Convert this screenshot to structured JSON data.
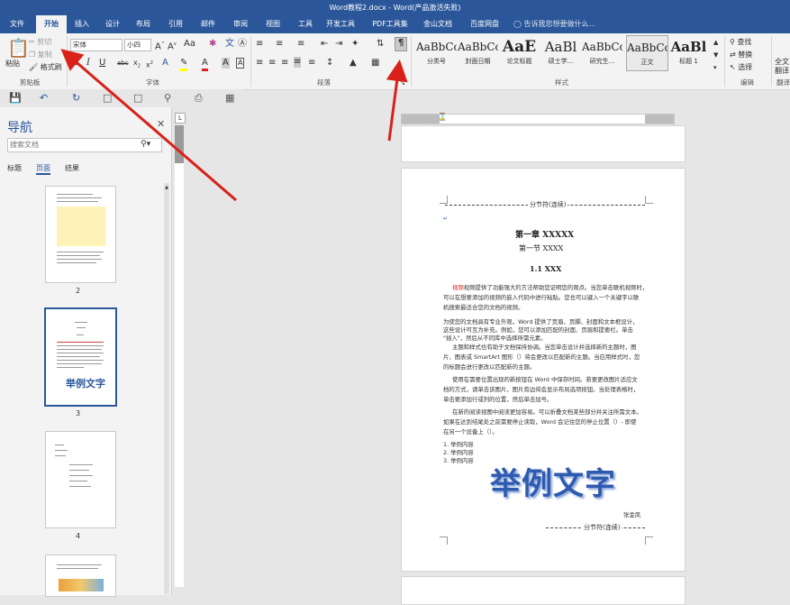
{
  "window": {
    "title": "Word教程2.docx - Word(产品激活失败)"
  },
  "tabs": [
    {
      "label": "文件"
    },
    {
      "label": "开始"
    },
    {
      "label": "插入"
    },
    {
      "label": "设计"
    },
    {
      "label": "布局"
    },
    {
      "label": "引用"
    },
    {
      "label": "邮件"
    },
    {
      "label": "审阅"
    },
    {
      "label": "视图"
    },
    {
      "label": "工具"
    },
    {
      "label": "开发工具"
    },
    {
      "label": "PDF工具集"
    },
    {
      "label": "金山文档"
    },
    {
      "label": "百度网盘"
    }
  ],
  "active_tab": "开始",
  "tell_me": "告诉我您想要做什么...",
  "ribbon": {
    "clipboard": {
      "paste": "粘贴",
      "cut": "剪切",
      "copy": "复制",
      "format_painter": "格式刷",
      "group": "剪贴板"
    },
    "font": {
      "font_name": "宋体",
      "font_size": "小四",
      "group": "字体"
    },
    "paragraph": {
      "group": "段落"
    },
    "styles": {
      "group": "样式",
      "items": [
        {
          "preview": "AaBbCc",
          "name": "分类号"
        },
        {
          "preview": "AaBbCc",
          "name": "封面日期"
        },
        {
          "preview": "AaE",
          "name": "论文标题"
        },
        {
          "preview": "AaBl",
          "name": "硕士学..."
        },
        {
          "preview": "AaBbCc",
          "name": "研究生..."
        },
        {
          "preview": "AaBbCcI",
          "name": "正文"
        },
        {
          "preview": "AaBl",
          "name": "标题 1"
        }
      ]
    },
    "editing": {
      "find": "查找",
      "replace": "替换",
      "select": "选择",
      "group": "编辑"
    },
    "extra": {
      "label1": "全文",
      "label2": "翻译",
      "group": "翻译"
    }
  },
  "nav": {
    "title": "导航",
    "search_placeholder": "搜索文档",
    "tabs": [
      {
        "label": "标题"
      },
      {
        "label": "页面"
      },
      {
        "label": "结果"
      }
    ],
    "active_tab": "页面",
    "pages": [
      {
        "num": "2"
      },
      {
        "num": "3"
      },
      {
        "num": "4"
      }
    ],
    "thumb_big_text": "举例文字"
  },
  "document": {
    "section_break_top": "分节符(连续)",
    "chapter": "第一章 XXXXX",
    "section": "第一节 XXXX",
    "subsection": "1.1 XXX",
    "paragraphs": [
      "视频提供了功能强大的方法帮助您证明您的观点。当您单击联机视频时，",
      "可以在想要添加的视频的嵌入代码中进行粘贴。您也可以键入一个关键字以联",
      "机搜索最适合您的文档的视频。",
      "为使您的文档具有专业外观，Word 提供了页眉、页脚、封面和文本框设计，",
      "这些设计可互为补充。例如，您可以添加匹配的封面、页眉和提要栏。单击",
      "\"插入\"，然后从不同库中选择所需元素。",
      "主题和样式也有助于文档保持协调。当您单击设计并选择新的主题时，图",
      "片、图表或 SmartArt 图形（）将会更改以匹配新的主题。当应用样式时，您",
      "的标题会进行更改以匹配新的主题。",
      "使用在需要位置出现的新按钮在 Word 中保存时间。若要更改图片适应文",
      "档的方式，请单击该图片，图片旁边将会显示布局选项按钮。当处理表格时，",
      "单击要添加行或列的位置，然后单击加号。",
      "在新的阅读视图中阅读更加容易。可以折叠文档某些部分并关注所需文本。",
      "如果在达到结尾处之前需要停止读取，Word 会记住您的停止位置（）- 即使",
      "在另一个设备上（）。"
    ],
    "list": [
      "1. 举例内容",
      "2. 举例内容",
      "3. 举例内容"
    ],
    "big_text": "举例文字",
    "signature": "张金凤",
    "section_break_bottom": "分节符(连续)"
  },
  "colors": {
    "accent": "#2b579a",
    "arrow": "#d9211a",
    "red_text": "#d2271b"
  }
}
